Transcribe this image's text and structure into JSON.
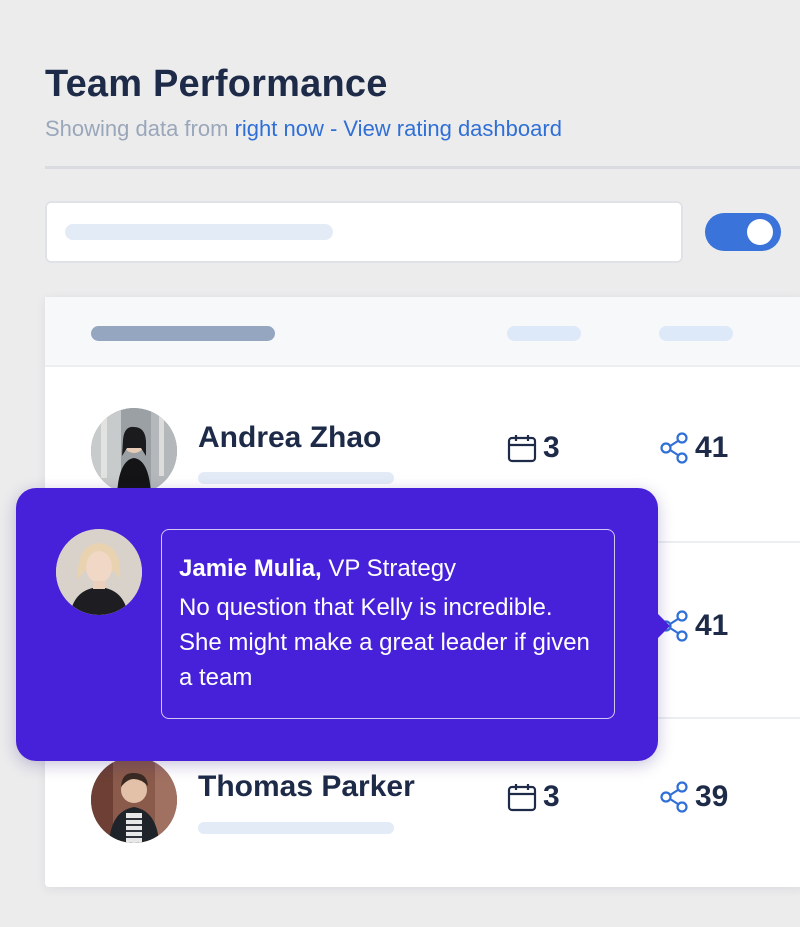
{
  "header": {
    "title": "Team Performance",
    "subtitle_prefix": "Showing data from",
    "subtitle_time_link": "right now",
    "subtitle_separator": " - ",
    "subtitle_dashboard_link": "View rating dashboard"
  },
  "controls": {
    "search_placeholder": "",
    "toggle_on": true
  },
  "colors": {
    "accent": "#2f6fd6",
    "popup_background": "#4721da",
    "title": "#1d2a48"
  },
  "table": {
    "rows": [
      {
        "name": "Andrea Zhao",
        "calendar_icon": "calendar-icon",
        "calendar_count": "3",
        "share_icon": "share-icon",
        "share_count": "41"
      },
      {
        "name": "",
        "calendar_icon": "calendar-icon",
        "calendar_count": "",
        "share_icon": "share-icon",
        "share_count": "41"
      },
      {
        "name": "Thomas Parker",
        "calendar_icon": "calendar-icon",
        "calendar_count": "3",
        "share_icon": "share-icon",
        "share_count": "39"
      }
    ]
  },
  "popup": {
    "author_name": "Jamie Mulia,",
    "author_role": "VP Strategy",
    "quote": "No question that Kelly is incredible. She might make a great leader if given a team"
  }
}
